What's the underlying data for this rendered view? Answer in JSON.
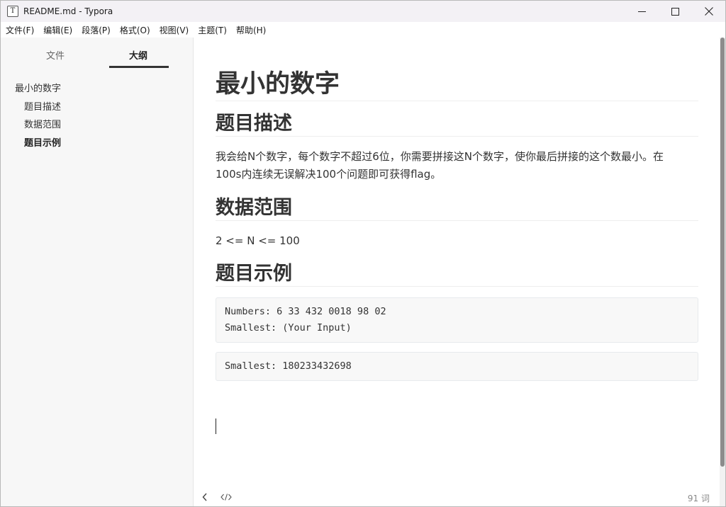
{
  "window": {
    "title": "README.md - Typora",
    "app_icon_letter": "T"
  },
  "menu": [
    "文件(F)",
    "编辑(E)",
    "段落(P)",
    "格式(O)",
    "视图(V)",
    "主题(T)",
    "帮助(H)"
  ],
  "sidebar": {
    "tabs": {
      "files": "文件",
      "outline": "大纲"
    },
    "active_tab": "outline",
    "outline": [
      {
        "label": "最小的数字",
        "level": 1,
        "active": false
      },
      {
        "label": "题目描述",
        "level": 2,
        "active": false
      },
      {
        "label": "数据范围",
        "level": 2,
        "active": false
      },
      {
        "label": "题目示例",
        "level": 2,
        "active": true
      }
    ]
  },
  "document": {
    "h1": "最小的数字",
    "section1": {
      "heading": "题目描述",
      "text_line1": "我会给N个数字，每个数字不超过6位，你需要拼接这N个数字，使你最后拼接的这个数最小。在",
      "text_line2": "100s内连续无误解决100个问题即可获得flag。"
    },
    "section2": {
      "heading": "数据范围",
      "text": "2 <= N <= 100"
    },
    "section3": {
      "heading": "题目示例",
      "code1": [
        "Numbers: 6 33 432 0018 98 02",
        "Smallest: (Your Input)"
      ],
      "code2": [
        "Smallest: 180233432698"
      ]
    }
  },
  "status": {
    "word_count": "91 词"
  }
}
